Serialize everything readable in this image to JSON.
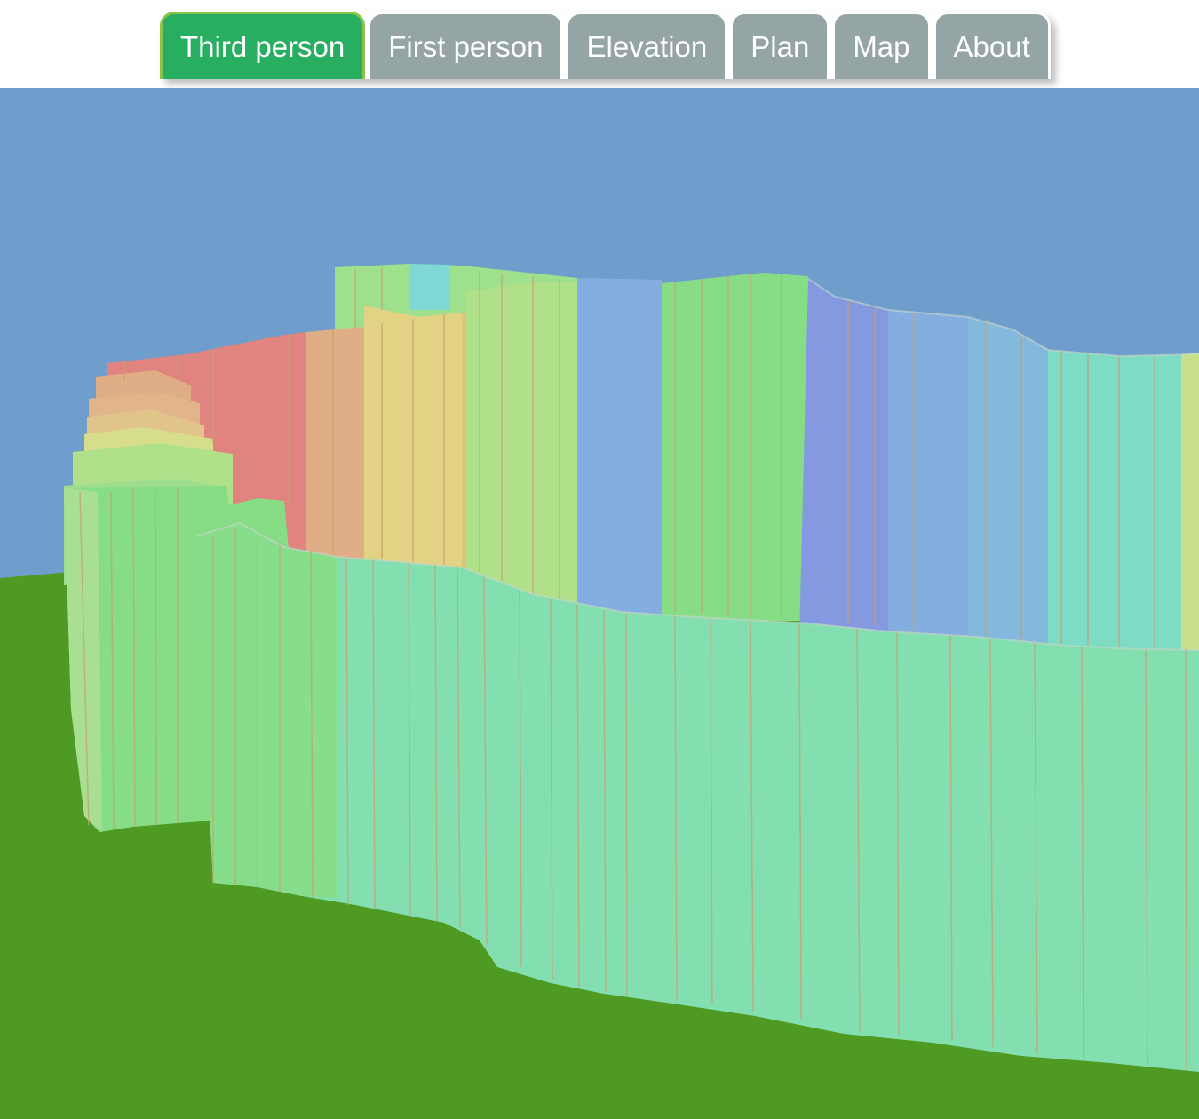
{
  "tabs": [
    {
      "label": "Third person",
      "active": true
    },
    {
      "label": "First person",
      "active": false
    },
    {
      "label": "Elevation",
      "active": false
    },
    {
      "label": "Plan",
      "active": false
    },
    {
      "label": "Map",
      "active": false
    },
    {
      "label": "About",
      "active": false
    }
  ],
  "scene": {
    "sky_color": "#6f9ecd",
    "ground_color": "#4e9a23",
    "wall_colors": [
      "#e1837f",
      "#e0ae86",
      "#e2d384",
      "#b0e08a",
      "#86dd86",
      "#83dfb0",
      "#85aee0",
      "#8499e0",
      "#7fd8d4"
    ]
  }
}
